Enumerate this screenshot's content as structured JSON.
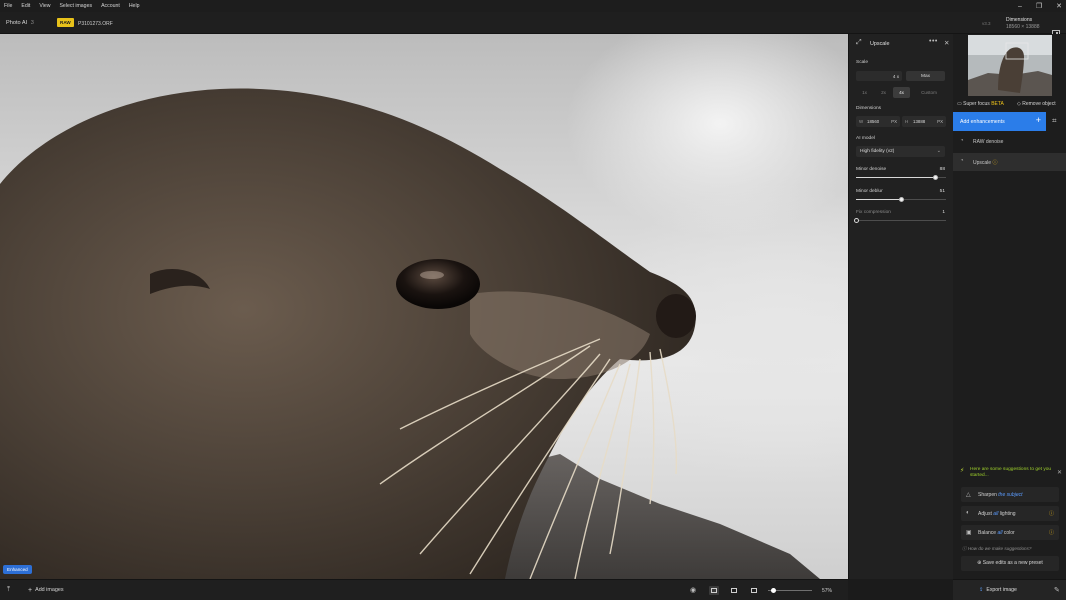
{
  "menu": [
    "File",
    "Edit",
    "View",
    "Select images",
    "Account",
    "Help"
  ],
  "window_controls": [
    "–",
    "❐",
    "✕"
  ],
  "header": {
    "app_name": "Photo AI",
    "app_version": "3",
    "raw_badge": "RAW",
    "filename": "P3101273.ORF",
    "ver_hint": "v3.3",
    "dimensions_label": "Dimensions",
    "dimensions_value": "18560 × 13888"
  },
  "canvas": {
    "enhanced_badge": "Enhanced"
  },
  "bottom_bar": {
    "add_images": "Add images",
    "zoom": "57%",
    "zoom_level": 0.12
  },
  "upscale_panel": {
    "title": "Upscale",
    "scale_label": "Scale",
    "scale_value": "4 x",
    "max_label": "Max",
    "scale_options": [
      "1x",
      "2x",
      "4x",
      "Custom"
    ],
    "selected_scale": "4x",
    "dimensions_label": "Dimensions",
    "width_key": "W",
    "width_value": "18560",
    "height_key": "H",
    "height_value": "13888",
    "unit": "PX",
    "ai_model_label": "AI model",
    "ai_model_value": "High fidelity (v2)",
    "sliders": [
      {
        "label": "Minor denoise",
        "value": "88",
        "fraction": 0.88
      },
      {
        "label": "Minor deblur",
        "value": "51",
        "fraction": 0.51
      },
      {
        "label": "Fix compression",
        "value": "1",
        "fraction": 0.0
      }
    ]
  },
  "sidebar": {
    "super_focus": "Super focus",
    "beta": "BETA",
    "remove_object": "Remove object",
    "add_enhancements": "Add enhancements",
    "enhancements": [
      {
        "label": "RAW denoise"
      },
      {
        "label": "Upscale"
      }
    ],
    "suggestions_head": "Here are some suggestions to get you started...",
    "suggestions": [
      {
        "verb": "Sharpen",
        "mid": "the",
        "obj": "subject"
      },
      {
        "verb": "Adjust",
        "mid": "all",
        "obj": "lighting"
      },
      {
        "verb": "Balance",
        "mid": "all",
        "obj": "color"
      }
    ],
    "how_text": "How do we make suggestions?",
    "save_preset": "Save edits as a new preset",
    "export": "Export image"
  },
  "colors": {
    "accent": "#2b7de9",
    "raw_badge": "#e8c21a",
    "suggestion": "#9ed02b"
  }
}
